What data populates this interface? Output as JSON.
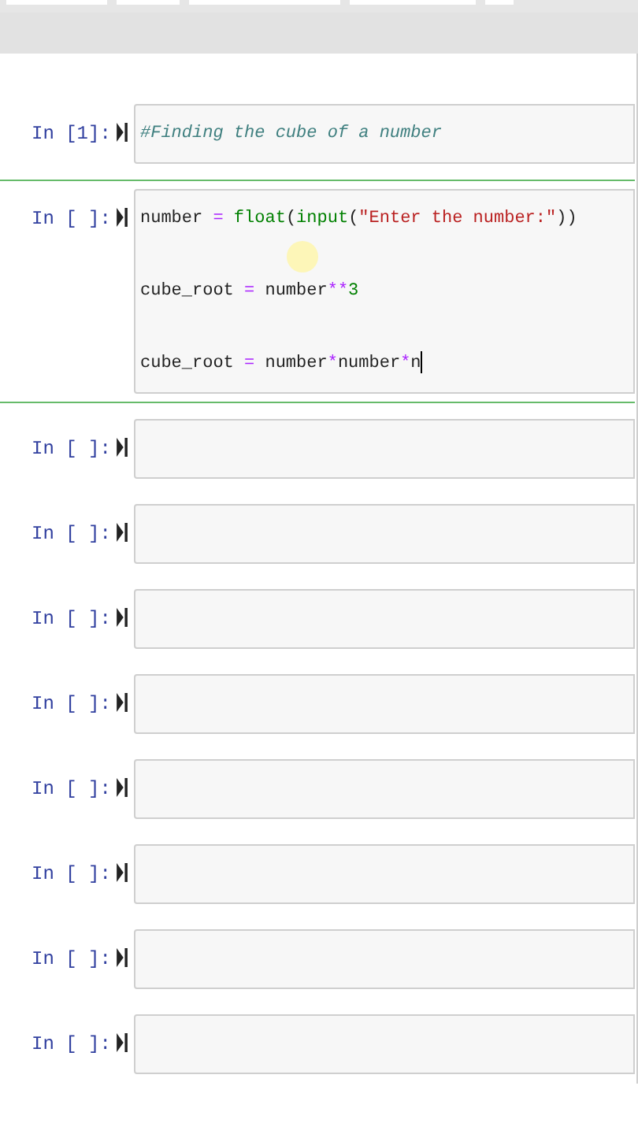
{
  "cells": [
    {
      "prompt": "In [1]:",
      "selected": false,
      "lines": [
        [
          {
            "kind": "comment",
            "text": "#Finding the cube of a number"
          }
        ]
      ]
    },
    {
      "prompt": "In [ ]:",
      "selected": true,
      "cursor": true,
      "lines": [
        [
          {
            "kind": "name",
            "text": "number "
          },
          {
            "kind": "operator",
            "text": "= "
          },
          {
            "kind": "builtin",
            "text": "float"
          },
          {
            "kind": "name",
            "text": "("
          },
          {
            "kind": "builtin",
            "text": "input"
          },
          {
            "kind": "name",
            "text": "("
          },
          {
            "kind": "string",
            "text": "\"Enter the number:\""
          },
          {
            "kind": "name",
            "text": "))"
          }
        ],
        [
          {
            "kind": "name",
            "text": "cube_root "
          },
          {
            "kind": "operator",
            "text": "="
          },
          {
            "kind": "name",
            "text": " number"
          },
          {
            "kind": "operator",
            "text": "**"
          },
          {
            "kind": "number",
            "text": "3"
          }
        ],
        [
          {
            "kind": "name",
            "text": "cube_root "
          },
          {
            "kind": "operator",
            "text": "="
          },
          {
            "kind": "name",
            "text": " number"
          },
          {
            "kind": "operator",
            "text": "*"
          },
          {
            "kind": "name",
            "text": "number"
          },
          {
            "kind": "operator",
            "text": "*"
          },
          {
            "kind": "name",
            "text": "n"
          }
        ]
      ]
    },
    {
      "prompt": "In [ ]:",
      "selected": false
    },
    {
      "prompt": "In [ ]:",
      "selected": false
    },
    {
      "prompt": "In [ ]:",
      "selected": false
    },
    {
      "prompt": "In [ ]:",
      "selected": false
    },
    {
      "prompt": "In [ ]:",
      "selected": false
    },
    {
      "prompt": "In [ ]:",
      "selected": false
    },
    {
      "prompt": "In [ ]:",
      "selected": false
    },
    {
      "prompt": "In [ ]:",
      "selected": false
    }
  ]
}
